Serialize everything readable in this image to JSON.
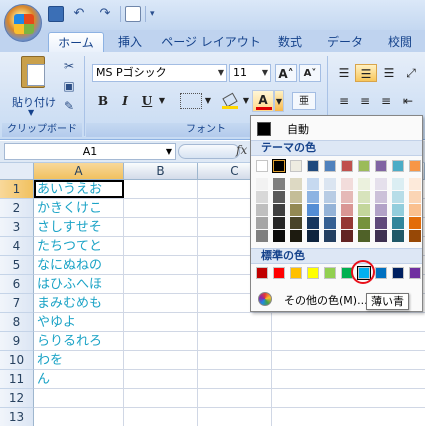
{
  "quick_access": {
    "undo": "↶",
    "redo": "↷",
    "more": "▾"
  },
  "tabs": [
    {
      "label": "ホーム",
      "active": true
    },
    {
      "label": "挿入"
    },
    {
      "label": "ページ レイアウト"
    },
    {
      "label": "数式"
    },
    {
      "label": "データ"
    },
    {
      "label": "校閲"
    }
  ],
  "ribbon": {
    "paste_label": "貼り付け",
    "cut_icon": "✂",
    "clipboard_group": "クリップボード",
    "font_group": "フォント",
    "font_name": "MS Pゴシック",
    "font_size": "11",
    "grow_font": "A˄",
    "shrink_font": "A˅",
    "bold": "B",
    "italic": "I",
    "underline": "U",
    "font_color_letter": "A",
    "phonetic": "亜",
    "font_color_bar": "#e00000"
  },
  "formula_bar": {
    "cell_ref": "A1",
    "fx": "fx"
  },
  "grid": {
    "columns": [
      "A",
      "B",
      "C"
    ],
    "rows": [
      "1",
      "2",
      "3",
      "4",
      "5",
      "6",
      "7",
      "8",
      "9",
      "10",
      "11",
      "12",
      "13"
    ],
    "column_a": [
      "あいうえお",
      "かきくけこ",
      "さしすせそ",
      "たちつてと",
      "なにぬねの",
      "はひふへほ",
      "まみむめも",
      "やゆよ",
      "らりるれろ",
      "わを",
      "ん",
      "",
      ""
    ],
    "text_color": "#1ba3c6"
  },
  "color_popup": {
    "auto_label": "自動",
    "theme_header": "テーマの色",
    "standard_header": "標準の色",
    "more_colors_label": "その他の色(M)...",
    "tooltip": "薄い青",
    "theme_base": [
      "#ffffff",
      "#000000",
      "#eeece1",
      "#1f497d",
      "#4f81bd",
      "#c0504d",
      "#9bbb59",
      "#8064a2",
      "#4bacc6",
      "#f79646"
    ],
    "theme_tints": [
      [
        "#f2f2f2",
        "#7f7f7f",
        "#ddd9c3",
        "#c6d9f0",
        "#dbe5f1",
        "#f2dcdb",
        "#ebf1dd",
        "#e5e0ec",
        "#dbeef3",
        "#fdeada"
      ],
      [
        "#d8d8d8",
        "#595959",
        "#c4bd97",
        "#8db3e2",
        "#b8cce4",
        "#e5b9b7",
        "#d7e3bc",
        "#ccc1d9",
        "#b7dde8",
        "#fbd5b5"
      ],
      [
        "#bfbfbf",
        "#3f3f3f",
        "#938953",
        "#548dd4",
        "#95b3d7",
        "#d99694",
        "#c3d69b",
        "#b2a2c7",
        "#92cddc",
        "#fac08f"
      ],
      [
        "#a5a5a5",
        "#262626",
        "#494429",
        "#17365d",
        "#366092",
        "#953734",
        "#76923c",
        "#5f497a",
        "#31859b",
        "#e36c09"
      ],
      [
        "#7f7f7f",
        "#0c0c0c",
        "#1d1b10",
        "#0f243e",
        "#244061",
        "#632423",
        "#4f6128",
        "#3f3151",
        "#205867",
        "#974806"
      ]
    ],
    "standard": [
      "#c00000",
      "#ff0000",
      "#ffc000",
      "#ffff00",
      "#92d050",
      "#00b050",
      "#00b0f0",
      "#0070c0",
      "#002060",
      "#7030a0"
    ],
    "selected_theme_index": 1,
    "highlighted_standard_index": 6
  }
}
